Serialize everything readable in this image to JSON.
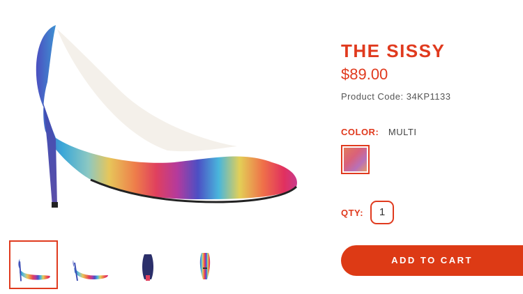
{
  "product": {
    "title": "THE SISSY",
    "price": "$89.00",
    "code_label": "Product Code:",
    "code_value": "34KP1133"
  },
  "color": {
    "label": "COLOR:",
    "value": "MULTI"
  },
  "quantity": {
    "label": "QTY:",
    "value": "1"
  },
  "cart": {
    "button_label": "ADD TO CART"
  },
  "gallery": {
    "selected_thumbnail": 1,
    "thumbnails": [
      "side-view",
      "three-quarter-view",
      "back-view",
      "front-view"
    ]
  },
  "colors": {
    "accent": "#e03a1e",
    "button": "#dd3a15"
  },
  "icons": {
    "main": "rainbow-glitter-pump-image",
    "swatch": "multi-color-swatch"
  }
}
